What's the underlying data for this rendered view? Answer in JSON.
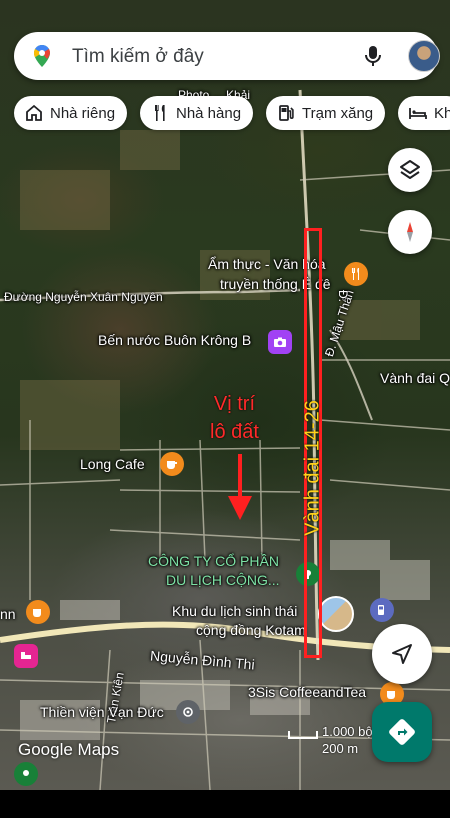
{
  "search": {
    "placeholder": "Tìm kiếm ở đây"
  },
  "chips": [
    {
      "label": "Nhà riêng",
      "icon": "home-icon"
    },
    {
      "label": "Nhà hàng",
      "icon": "restaurant-icon"
    },
    {
      "label": "Trạm xăng",
      "icon": "gas-station-icon"
    },
    {
      "label": "Kh",
      "icon": "hotel-icon"
    }
  ],
  "labels": {
    "photo_top": "Photo ... Khải",
    "am_thuc": "Ẩm thực - Văn hóa",
    "truyen_thong": "truyền thống Ê đê",
    "nguyen_xuan_nguyen": "Đường Nguyễn Xuân Nguyên",
    "ben_nuoc": "Bến nước Buôn Krông B",
    "mau_than": "Đ. Mậu Thân",
    "vanh_dai_q": "Vành đai Q",
    "long_cafe": "Long Cafe",
    "cong_ty_1": "CÔNG TY CỔ PHẦN",
    "cong_ty_2": "DU LỊCH CỘNG...",
    "khu_du_lich_1": "Khu du lịch sinh thái",
    "khu_du_lich_2": "cộng đồng Kotam",
    "nn": "nn",
    "nguyen_dinh_thi": "Nguyễn Đình Thi",
    "tran_kien": "Trần Kiên",
    "coffee": "3Sis CoffeeandTea",
    "thien_vien": "Thiền viện Vạn Đức",
    "road_d": "Đ."
  },
  "annotations": {
    "ring_road": "Vành đai 14-26",
    "lot_line1": "Vị trí",
    "lot_line2": "lô đất"
  },
  "scale": {
    "feet": "1.000 bộ",
    "meters": "200 m"
  },
  "brand": "Google Maps",
  "colors": {
    "annotation_red": "#ff2020",
    "ring_text_yellow": "#ffd21a",
    "fab_teal": "#00796b",
    "poi_orange": "#f28b1c",
    "poi_purple": "#a142f4",
    "poi_pink": "#e52592"
  }
}
